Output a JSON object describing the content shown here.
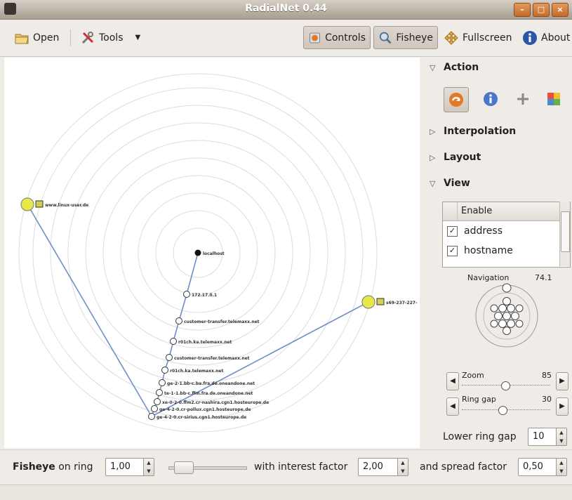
{
  "window": {
    "title": "RadialNet 0.44"
  },
  "toolbar": {
    "open_label": "Open",
    "tools_label": "Tools",
    "controls_label": "Controls",
    "fisheye_label": "Fisheye",
    "fullscreen_label": "Fullscreen",
    "about_label": "About"
  },
  "graph": {
    "nodes": [
      {
        "label": "localhost"
      },
      {
        "label": "172.17.0.1"
      },
      {
        "label": "customer-transfer.telemaxx.net"
      },
      {
        "label": "r01ch.ka.telemaxx.net"
      },
      {
        "label": "customer-transfer.telemaxx.net"
      },
      {
        "label": "r01ch.ka.telemaxx.net"
      },
      {
        "label": "ge-2-1.bb-c.ba.fra.de.oneandone.net"
      },
      {
        "label": "te-1-1.bb-c.ffm.fra.de.oneandone.net"
      },
      {
        "label": "xe-0-2-0.ffm2.cr-nashira.cgn1.hosteurope.de"
      },
      {
        "label": "ge-4-2-0.cr-pollux.cgn1.hosteurope.de"
      },
      {
        "label": "ge-4-2-0.cr-sirius.cgn1.hosteurope.de"
      },
      {
        "label": "www.linux-user.de"
      },
      {
        "label": "s69-237-227-"
      }
    ]
  },
  "panel": {
    "action_label": "Action",
    "interpolation_label": "Interpolation",
    "layout_label": "Layout",
    "view_label": "View",
    "table": {
      "header": "Enable",
      "rows": [
        {
          "label": "address",
          "checked": true
        },
        {
          "label": "hostname",
          "checked": true
        }
      ]
    },
    "navigation_label": "Navigation",
    "navigation_value": "74.1",
    "zoom_label": "Zoom",
    "zoom_value": "85",
    "ring_gap_label": "Ring gap",
    "ring_gap_value": "30",
    "lower_ring_gap_label": "Lower ring gap",
    "lower_ring_gap_value": "10"
  },
  "bottom": {
    "fisheye_label": "Fisheye",
    "on_ring_label": "on ring",
    "ring_value": "1,00",
    "interest_label": "with interest factor",
    "interest_value": "2,00",
    "spread_label": "and spread factor",
    "spread_value": "0,50"
  }
}
